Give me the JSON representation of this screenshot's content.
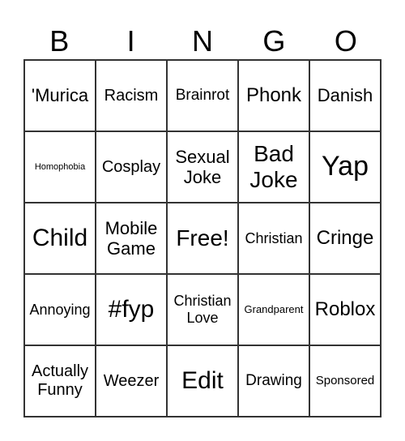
{
  "header": [
    "B",
    "I",
    "N",
    "G",
    "O"
  ],
  "cells": [
    "'Murica",
    "Racism",
    "Brainrot",
    "Phonk",
    "Danish",
    "Homophobia",
    "Cosplay",
    "Sexual Joke",
    "Bad Joke",
    "Yap",
    "Child",
    "Mobile Game",
    "Free!",
    "Christian",
    "Cringe",
    "Annoying",
    "#fyp",
    "Christian Love",
    "Grandparent",
    "Roblox",
    "Actually Funny",
    "Weezer",
    "Edit",
    "Drawing",
    "Sponsored"
  ]
}
